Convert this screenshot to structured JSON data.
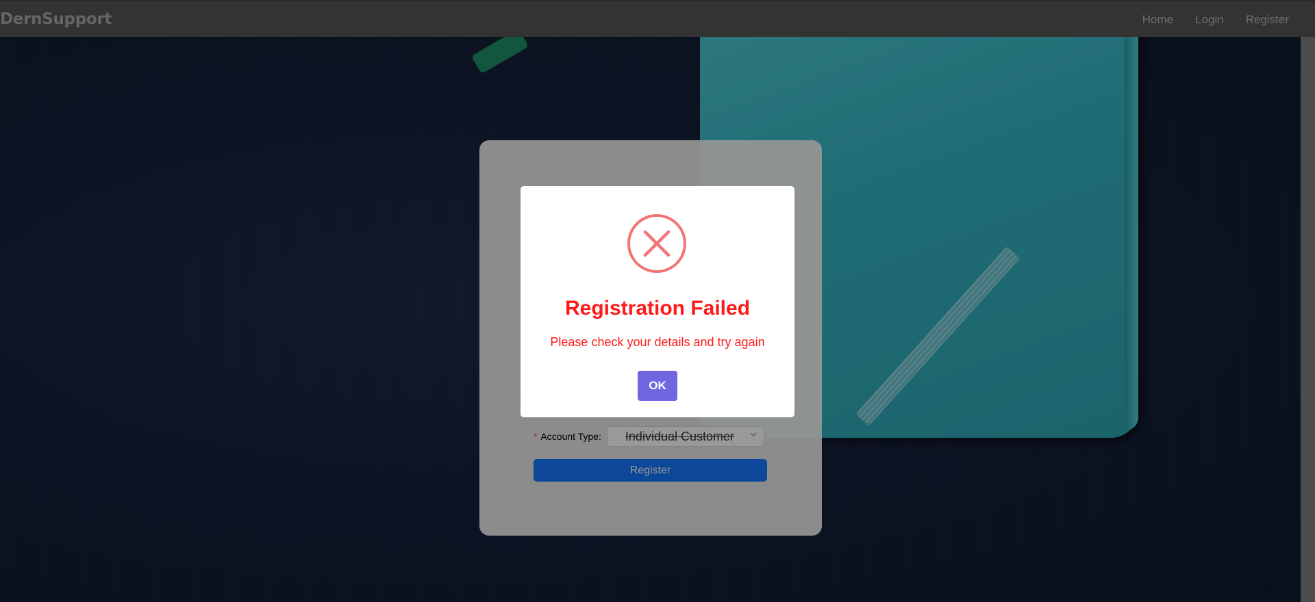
{
  "navbar": {
    "brand": "DernSupport",
    "links": [
      {
        "label": "Home"
      },
      {
        "label": "Login"
      },
      {
        "label": "Register"
      }
    ]
  },
  "register_form": {
    "account_type_required_mark": "*",
    "account_type_label": "Account Type:",
    "account_type_value": "Individual Customer",
    "submit_label": "Register"
  },
  "alert": {
    "icon": "error-x-icon",
    "title": "Registration Failed",
    "message": "Please check your details and try again",
    "ok_label": "OK",
    "colors": {
      "title": "#ff1a1a",
      "icon": "#f27474",
      "ok_button": "#7066e0"
    }
  },
  "colors": {
    "navbar": "#555555",
    "primary_button": "#1677ff"
  }
}
